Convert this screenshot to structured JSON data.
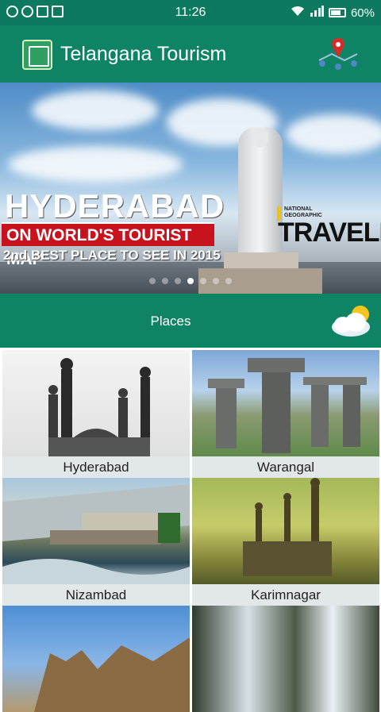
{
  "status_bar": {
    "time": "11:26",
    "battery": "60%"
  },
  "app_bar": {
    "title": "Telangana Tourism",
    "logo_icon": "telangana-emblem-icon",
    "map_icon": "map-locations-icon"
  },
  "banner": {
    "headline_1": "HYDERABAD",
    "headline_2": "ON WORLD'S TOURIST MAP",
    "headline_3": "2nd BEST PLACE TO SEE IN 2015",
    "brand_small": "NATIONAL GEOGRAPHIC",
    "brand_large": "TRAVELER",
    "slide_count": 7,
    "active_slide": 4
  },
  "places_bar": {
    "label": "Places",
    "weather_icon": "cloud-sun-icon"
  },
  "places": [
    {
      "name": "Hyderabad"
    },
    {
      "name": "Warangal"
    },
    {
      "name": "Nizambad"
    },
    {
      "name": "Karimnagar"
    },
    {
      "name": ""
    },
    {
      "name": ""
    }
  ]
}
